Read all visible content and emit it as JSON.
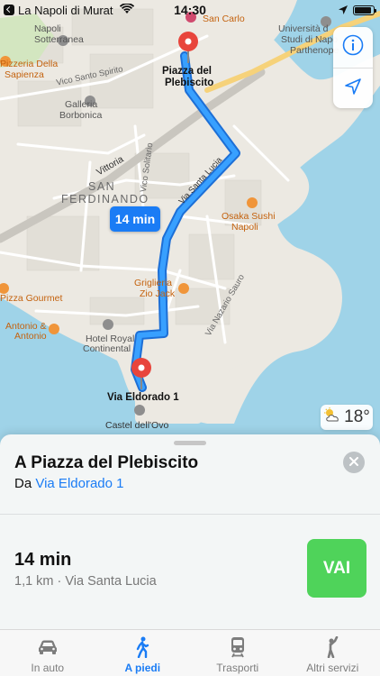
{
  "status_bar": {
    "back_app": "La Napoli di Murat",
    "time": "14:30",
    "battery_level": 0.9
  },
  "map": {
    "labels": {
      "san_carlo": "San Carlo",
      "napoli_sotterranea_1": "Napoli",
      "napoli_sotterranea_2": "Sotterranea",
      "pizzeria_1": "Pizzeria Della",
      "pizzeria_2": "Sapienza",
      "vico_santo_spirito": "Vico Santo Spirito",
      "galleria_1": "Galleria",
      "galleria_2": "Borbonica",
      "san_1": "SAN",
      "san_2": "FERDINANDO",
      "vittoria": "Vittoria",
      "vico_solitario": "Vico Solitario",
      "via_santa_lucia": "Via Santa Lucia",
      "osaka_1": "Osaka Sushi",
      "osaka_2": "Napoli",
      "griglieria_1": "Griglieria",
      "griglieria_2": "Zio Jack",
      "pizza_gourmet": "Pizza Gourmet",
      "antonio_1": "Antonio &",
      "antonio_2": "Antonio",
      "hotel_1": "Hotel Royal",
      "hotel_2": "Continental",
      "via_nazario_sauro": "Via Nazario Sauro",
      "castel": "Castel dell'Ovo",
      "univ_1": "Università d",
      "univ_2": "Studi di Napo",
      "univ_3": "Parthenope",
      "dest_pin_1": "Piazza del",
      "dest_pin_2": "Plebiscito",
      "origin_pin": "Via Eldorado 1"
    },
    "route_time": "14 min",
    "weather_temp": "18°"
  },
  "colors": {
    "route": "#1a7cf5",
    "go": "#4fd35a",
    "pin": "#e8453c",
    "water": "#9fd3e8"
  },
  "sheet": {
    "title": "A Piazza del Plebiscito",
    "from_prefix": "Da",
    "from_place": "Via Eldorado 1",
    "eta": "14 min",
    "details": "1,1 km · Via Santa Lucia",
    "go_label": "VAI"
  },
  "tabs": [
    {
      "label": "In auto",
      "icon": "car-icon",
      "active": false
    },
    {
      "label": "A piedi",
      "icon": "walking-icon",
      "active": true
    },
    {
      "label": "Trasporti",
      "icon": "train-icon",
      "active": false
    },
    {
      "label": "Altri servizi",
      "icon": "hailing-person-icon",
      "active": false
    }
  ]
}
